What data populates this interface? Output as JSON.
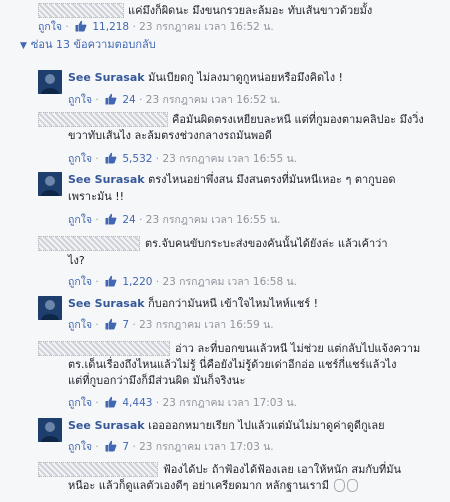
{
  "colors": {
    "link": "#4267b2",
    "name": "#365899",
    "meta": "#90949c",
    "background": "#f6f7f9"
  },
  "labels": {
    "like": "ถูกใจ",
    "sep": "·"
  },
  "replies_toggle": {
    "label": "ซ่อน 13 ข้อความตอบกลับ",
    "icon": "arrow-down-icon"
  },
  "comments": [
    {
      "author": "",
      "author_redacted": true,
      "lines": [
        "แค่มึงก็ผิดนะ มึงขนกรวยละล้มอะ ทับเส้นขาวด้วยมั้ง"
      ],
      "likes": "11,218",
      "time": "23 กรกฎาคม เวลา 16:52 น."
    },
    {
      "author": "See Surasak",
      "author_redacted": false,
      "lines": [
        "มันเบียดกู ไม่ลงมาดูกูหน่อยหรือมึงคิดไง !"
      ],
      "likes": "24",
      "time": "23 กรกฎาคม เวลา 16:52 น."
    },
    {
      "author": "",
      "author_redacted": true,
      "lines": [
        "คือมันผิดตรงเหยียบละหนี แต่ที่กูมองตามคลิปอะ มึงวิ่ง",
        "ขวาทับเส้นไง ละล้มตรงช่วงกลางรถมันพอดี"
      ],
      "likes": "5,532",
      "time": "23 กรกฎาคม เวลา 16:55 น."
    },
    {
      "author": "See Surasak",
      "author_redacted": false,
      "lines": [
        "ตรงไหนอย่าพึ่งสน มึงสนตรงที่มันหนีเหอะ ๆ ตากูบอด",
        "เพราะมัน !!"
      ],
      "likes": "24",
      "time": "23 กรกฎาคม เวลา 16:55 น."
    },
    {
      "author": "",
      "author_redacted": true,
      "lines": [
        "ตร.จับคนขับกระบะส่งของคันนั้นได้ยังล่ะ แล้วเค้าว่า",
        "ไง?"
      ],
      "likes": "1,220",
      "time": "23 กรกฎาคม เวลา 16:58 น."
    },
    {
      "author": "See Surasak",
      "author_redacted": false,
      "lines": [
        "ก็บอกว่ามันหนี เข้าใจไหมไหห์แชร์ !"
      ],
      "likes": "7",
      "time": "23 กรกฎาคม เวลา 16:59 น."
    },
    {
      "author": "",
      "author_redacted": true,
      "lines": [
        "อ่าว ละที่บอกขนแล้วหนี ไม่ช่วย แต่กลับไปแจ้งความ",
        "ตร.เด็นเรื่องถึงไหนแล้วไม่รู้ นี่คือยังไม่รู้ด้วยเด่าอีกอ่อ แชร์กี่แชร์แล้วไง",
        "แต่ที่กูบอกว่ามึงก็มีส่วนผิด มันก็จริงนะ"
      ],
      "likes": "4,443",
      "time": "23 กรกฎาคม เวลา 17:03 น."
    },
    {
      "author": "See Surasak",
      "author_redacted": false,
      "lines": [
        "เออออกหมายเรียก ไปแล้วแต่มันไม่มาดูค่าดูดีกูเลย"
      ],
      "likes": "7",
      "time": "23 กรกฎาคม เวลา 17:03 น."
    },
    {
      "author": "",
      "author_redacted": true,
      "lines": [
        "ฟ้องได้ปะ ถ้าฟ้องได้ฟ้องเลย เอาให้หนัก สมกับที่มัน",
        "หนีอะ แล้วก็ดูแลตัวเองดีๆ อย่าเครียดมาก หลักฐานเรามี"
      ],
      "likes": "",
      "time": ""
    }
  ]
}
